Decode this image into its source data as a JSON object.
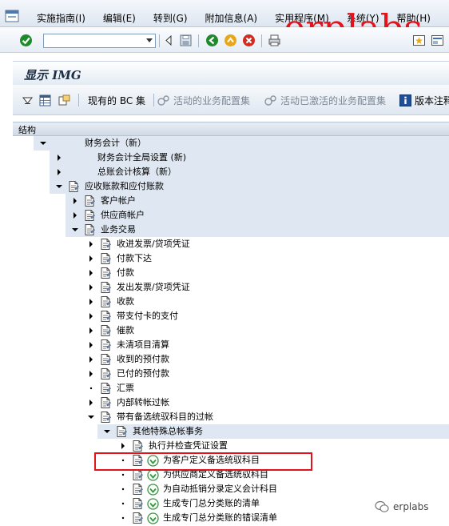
{
  "menu": {
    "items": [
      "实施指南(I)",
      "编辑(E)",
      "转到(G)",
      "附加信息(A)",
      "实用程序(M)",
      "系统(Y)",
      "帮助(H)"
    ]
  },
  "watermark_text": "erplabs",
  "page_title": "显示 IMG",
  "app_toolbar": {
    "existing_bc_sets": "现有的 BC 集",
    "active_biz_configs": "活动的业务配置集",
    "activated_biz_configs": "活动已激活的业务配置集",
    "version_comments": "版本注释"
  },
  "tree": {
    "header": "结构",
    "rows": [
      {
        "level": 0,
        "expander": "expanded",
        "icon": "none",
        "label": "财务会计（新）",
        "band": true
      },
      {
        "level": 1,
        "expander": "collapsed",
        "icon": "none",
        "label": "财务会计全局设置 (新)",
        "band": true
      },
      {
        "level": 1,
        "expander": "collapsed",
        "icon": "none",
        "label": "总账会计核算（新）",
        "band": true
      },
      {
        "level": 1,
        "expander": "expanded",
        "icon": "doc",
        "label": "应收账款和应付账款",
        "band": true
      },
      {
        "level": 2,
        "expander": "collapsed",
        "icon": "doc",
        "label": "客户帐户",
        "band": true
      },
      {
        "level": 2,
        "expander": "collapsed",
        "icon": "doc",
        "label": "供应商帐户",
        "band": true
      },
      {
        "level": 2,
        "expander": "expanded",
        "icon": "doc",
        "label": "业务交易",
        "band": true
      },
      {
        "level": 3,
        "expander": "collapsed",
        "icon": "doc",
        "label": "收进发票/贷项凭证",
        "band": false
      },
      {
        "level": 3,
        "expander": "collapsed",
        "icon": "doc",
        "label": "付款下达",
        "band": false
      },
      {
        "level": 3,
        "expander": "collapsed",
        "icon": "doc",
        "label": "付款",
        "band": false
      },
      {
        "level": 3,
        "expander": "collapsed",
        "icon": "doc",
        "label": "发出发票/贷项凭证",
        "band": false
      },
      {
        "level": 3,
        "expander": "collapsed",
        "icon": "doc",
        "label": "收款",
        "band": false
      },
      {
        "level": 3,
        "expander": "collapsed",
        "icon": "doc",
        "label": "带支付卡的支付",
        "band": false
      },
      {
        "level": 3,
        "expander": "collapsed",
        "icon": "doc",
        "label": "催款",
        "band": false
      },
      {
        "level": 3,
        "expander": "collapsed",
        "icon": "doc",
        "label": "未清项目清算",
        "band": false
      },
      {
        "level": 3,
        "expander": "collapsed",
        "icon": "doc",
        "label": "收到的预付款",
        "band": false
      },
      {
        "level": 3,
        "expander": "collapsed",
        "icon": "doc",
        "label": "已付的预付款",
        "band": false
      },
      {
        "level": 3,
        "expander": "leaf",
        "icon": "doc",
        "label": "汇票",
        "band": false
      },
      {
        "level": 3,
        "expander": "collapsed",
        "icon": "doc",
        "label": "内部转帐过帐",
        "band": false
      },
      {
        "level": 3,
        "expander": "expanded",
        "icon": "doc",
        "label": "带有备选统驭科目的过帐",
        "band": false
      },
      {
        "level": 4,
        "expander": "expanded",
        "icon": "doc",
        "label": "其他特殊总帐事务",
        "band": true
      },
      {
        "level": 5,
        "expander": "collapsed",
        "icon": "doc",
        "label": "执行并检查凭证设置",
        "band": false
      },
      {
        "level": 5,
        "expander": "leaf",
        "icon": "doc-exec",
        "label": "为客户定义备选统驭科目",
        "band": false
      },
      {
        "level": 5,
        "expander": "leaf",
        "icon": "doc-exec",
        "label": "为供应商定义备选统驭科目",
        "band": false
      },
      {
        "level": 5,
        "expander": "leaf",
        "icon": "doc-exec",
        "label": "为自动抵销分录定义会计科目",
        "band": false
      },
      {
        "level": 5,
        "expander": "leaf",
        "icon": "doc-exec",
        "label": "生成专门总分类账的清单",
        "band": false
      },
      {
        "level": 5,
        "expander": "leaf",
        "icon": "doc-exec",
        "label": "生成专门总分类账的错误清单",
        "band": false
      }
    ]
  },
  "wechat_badge": "erplabs",
  "colors": {
    "band": "#dfe8f2",
    "accent_red": "#e3131b",
    "exec_green": "#2f9a3a"
  }
}
